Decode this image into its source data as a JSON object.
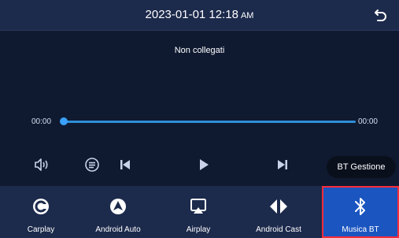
{
  "header": {
    "datetime": "2023-01-01 12:18",
    "ampm": "AM"
  },
  "player": {
    "status": "Non collegati",
    "current_time": "00:00",
    "total_time": "00:00",
    "progress": 0
  },
  "controls": {
    "bt_manage_label": "BT Gestione"
  },
  "nav": [
    {
      "label": "Carplay",
      "icon": "carplay-icon"
    },
    {
      "label": "Android Auto",
      "icon": "android-auto-icon"
    },
    {
      "label": "Airplay",
      "icon": "airplay-icon"
    },
    {
      "label": "Android Cast",
      "icon": "android-cast-icon"
    },
    {
      "label": "Musica BT",
      "icon": "bluetooth-icon",
      "active": true
    }
  ],
  "colors": {
    "background": "#101b33",
    "bar": "#1c2a4c",
    "accent": "#2f8ed8",
    "active_tab": "#1b55c0",
    "highlight_border": "#ff2d3a"
  }
}
